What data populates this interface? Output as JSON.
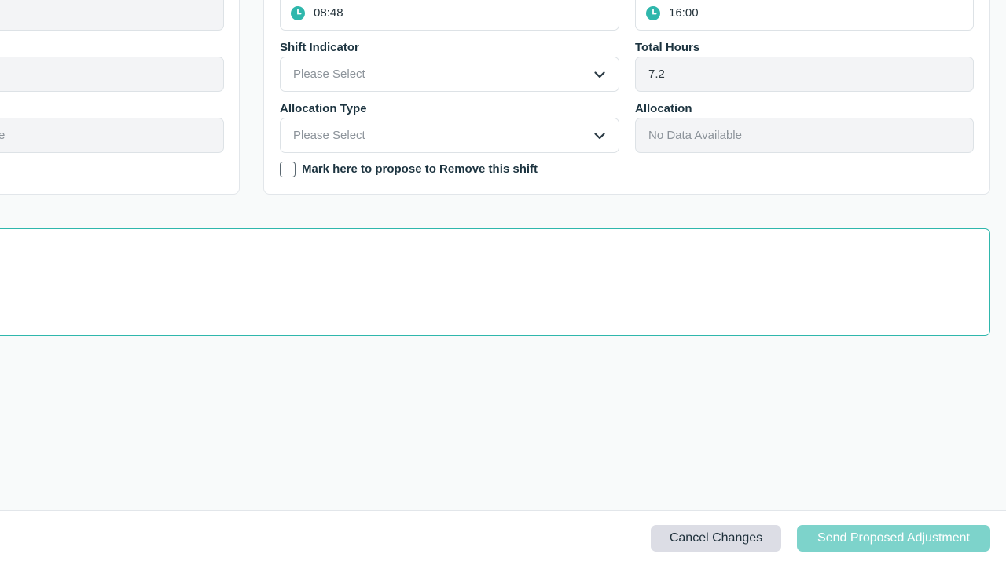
{
  "left_panel": {
    "field_3_fragment": "e"
  },
  "shift": {
    "start_time": "08:48",
    "end_time": "16:00",
    "shift_indicator": {
      "label": "Shift Indicator",
      "placeholder": "Please Select"
    },
    "total_hours": {
      "label": "Total Hours",
      "value": "7.2"
    },
    "allocation_type": {
      "label": "Allocation Type",
      "placeholder": "Please Select"
    },
    "allocation": {
      "label": "Allocation",
      "value": "No Data Available"
    },
    "remove_checkbox_label": "Mark here to propose to Remove this shift"
  },
  "footer": {
    "cancel_label": "Cancel Changes",
    "send_label": "Send Proposed Adjustment"
  },
  "colors": {
    "accent": "#2fb7ac",
    "send_button": "#7dd3cb",
    "cancel_button": "#dcdde5",
    "text_dark": "#1d3440"
  },
  "icons": {
    "time": "clock-icon",
    "dropdown": "chevron-down-icon"
  }
}
